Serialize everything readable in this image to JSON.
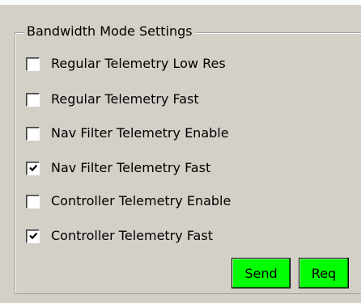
{
  "group": {
    "title": "Bandwidth Mode Settings"
  },
  "options": [
    {
      "label": "Regular Telemetry Low Res",
      "checked": false
    },
    {
      "label": "Regular Telemetry Fast",
      "checked": false
    },
    {
      "label": "Nav Filter Telemetry Enable",
      "checked": false
    },
    {
      "label": "Nav Filter Telemetry Fast",
      "checked": true
    },
    {
      "label": "Controller Telemetry Enable",
      "checked": false
    },
    {
      "label": "Controller Telemetry Fast",
      "checked": true
    }
  ],
  "buttons": {
    "send_label": "Send",
    "req_label": "Req"
  },
  "colors": {
    "button_bg": "#00ff00",
    "panel_bg": "#d4d0c8"
  }
}
